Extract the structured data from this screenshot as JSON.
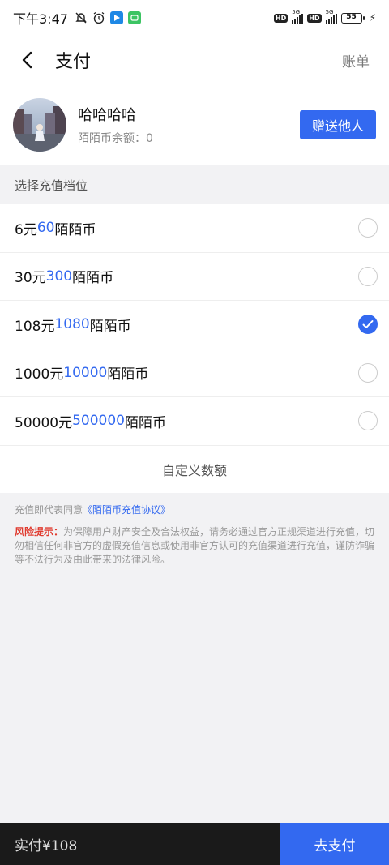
{
  "status_bar": {
    "time": "下午3:47",
    "battery": "55",
    "net1": "5G",
    "net2": "5G",
    "hd": "HD"
  },
  "nav": {
    "title": "支付",
    "right_label": "账单"
  },
  "profile": {
    "name": "哈哈哈哈",
    "balance_label": "陌陌币余额：",
    "balance_value": "0",
    "gift_button": "赠送他人"
  },
  "section_title": "选择充值档位",
  "tiers": [
    {
      "price": "6元",
      "coins": "60",
      "unit": "陌陌币",
      "selected": false
    },
    {
      "price": "30元",
      "coins": "300",
      "unit": "陌陌币",
      "selected": false
    },
    {
      "price": "108元",
      "coins": "1080",
      "unit": "陌陌币",
      "selected": true
    },
    {
      "price": "1000元",
      "coins": "10000",
      "unit": "陌陌币",
      "selected": false
    },
    {
      "price": "50000元",
      "coins": "500000",
      "unit": "陌陌币",
      "selected": false
    }
  ],
  "custom_amount": "自定义数额",
  "agreement": {
    "prefix": "充值即代表同意",
    "link": "《陌陌币充值协议》"
  },
  "risk": {
    "title": "风险提示：",
    "text": "为保障用户财产安全及合法权益，请务必通过官方正规渠道进行充值，切勿相信任何非官方的虚假充值信息或使用非官方认可的充值渠道进行充值，谨防诈骗等不法行为及由此带来的法律风险。"
  },
  "bottom": {
    "total": "实付¥108",
    "pay_button": "去支付"
  },
  "colors": {
    "accent": "#3369f0",
    "risk": "#e03a2e",
    "bottom_bar": "#1a1a1a"
  }
}
